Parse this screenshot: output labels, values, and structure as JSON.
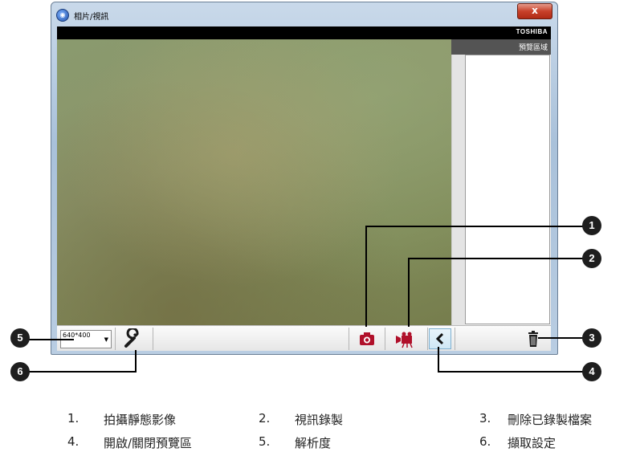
{
  "window": {
    "title": "相片/視訊",
    "close_label": "x",
    "brand": "TOSHIBA",
    "preview_header": "預覽區域"
  },
  "toolbar": {
    "resolution_value": "640*400",
    "icons": [
      "wrench-icon",
      "camera-icon",
      "video-camera-icon",
      "chevron-left-icon",
      "trash-icon"
    ]
  },
  "callouts": [
    "1",
    "2",
    "3",
    "4",
    "5",
    "6"
  ],
  "legend": [
    {
      "num": "1.",
      "label": "拍攝靜態影像"
    },
    {
      "num": "2.",
      "label": "視訊錄製"
    },
    {
      "num": "3.",
      "label": "刪除已錄製檔案"
    },
    {
      "num": "4.",
      "label": "開啟/關閉預覽區"
    },
    {
      "num": "5.",
      "label": "解析度"
    },
    {
      "num": "6.",
      "label": "擷取設定"
    }
  ],
  "colors": {
    "accent_red": "#b0102a",
    "titlebar": "#b9cde2",
    "close": "#c8412a"
  }
}
